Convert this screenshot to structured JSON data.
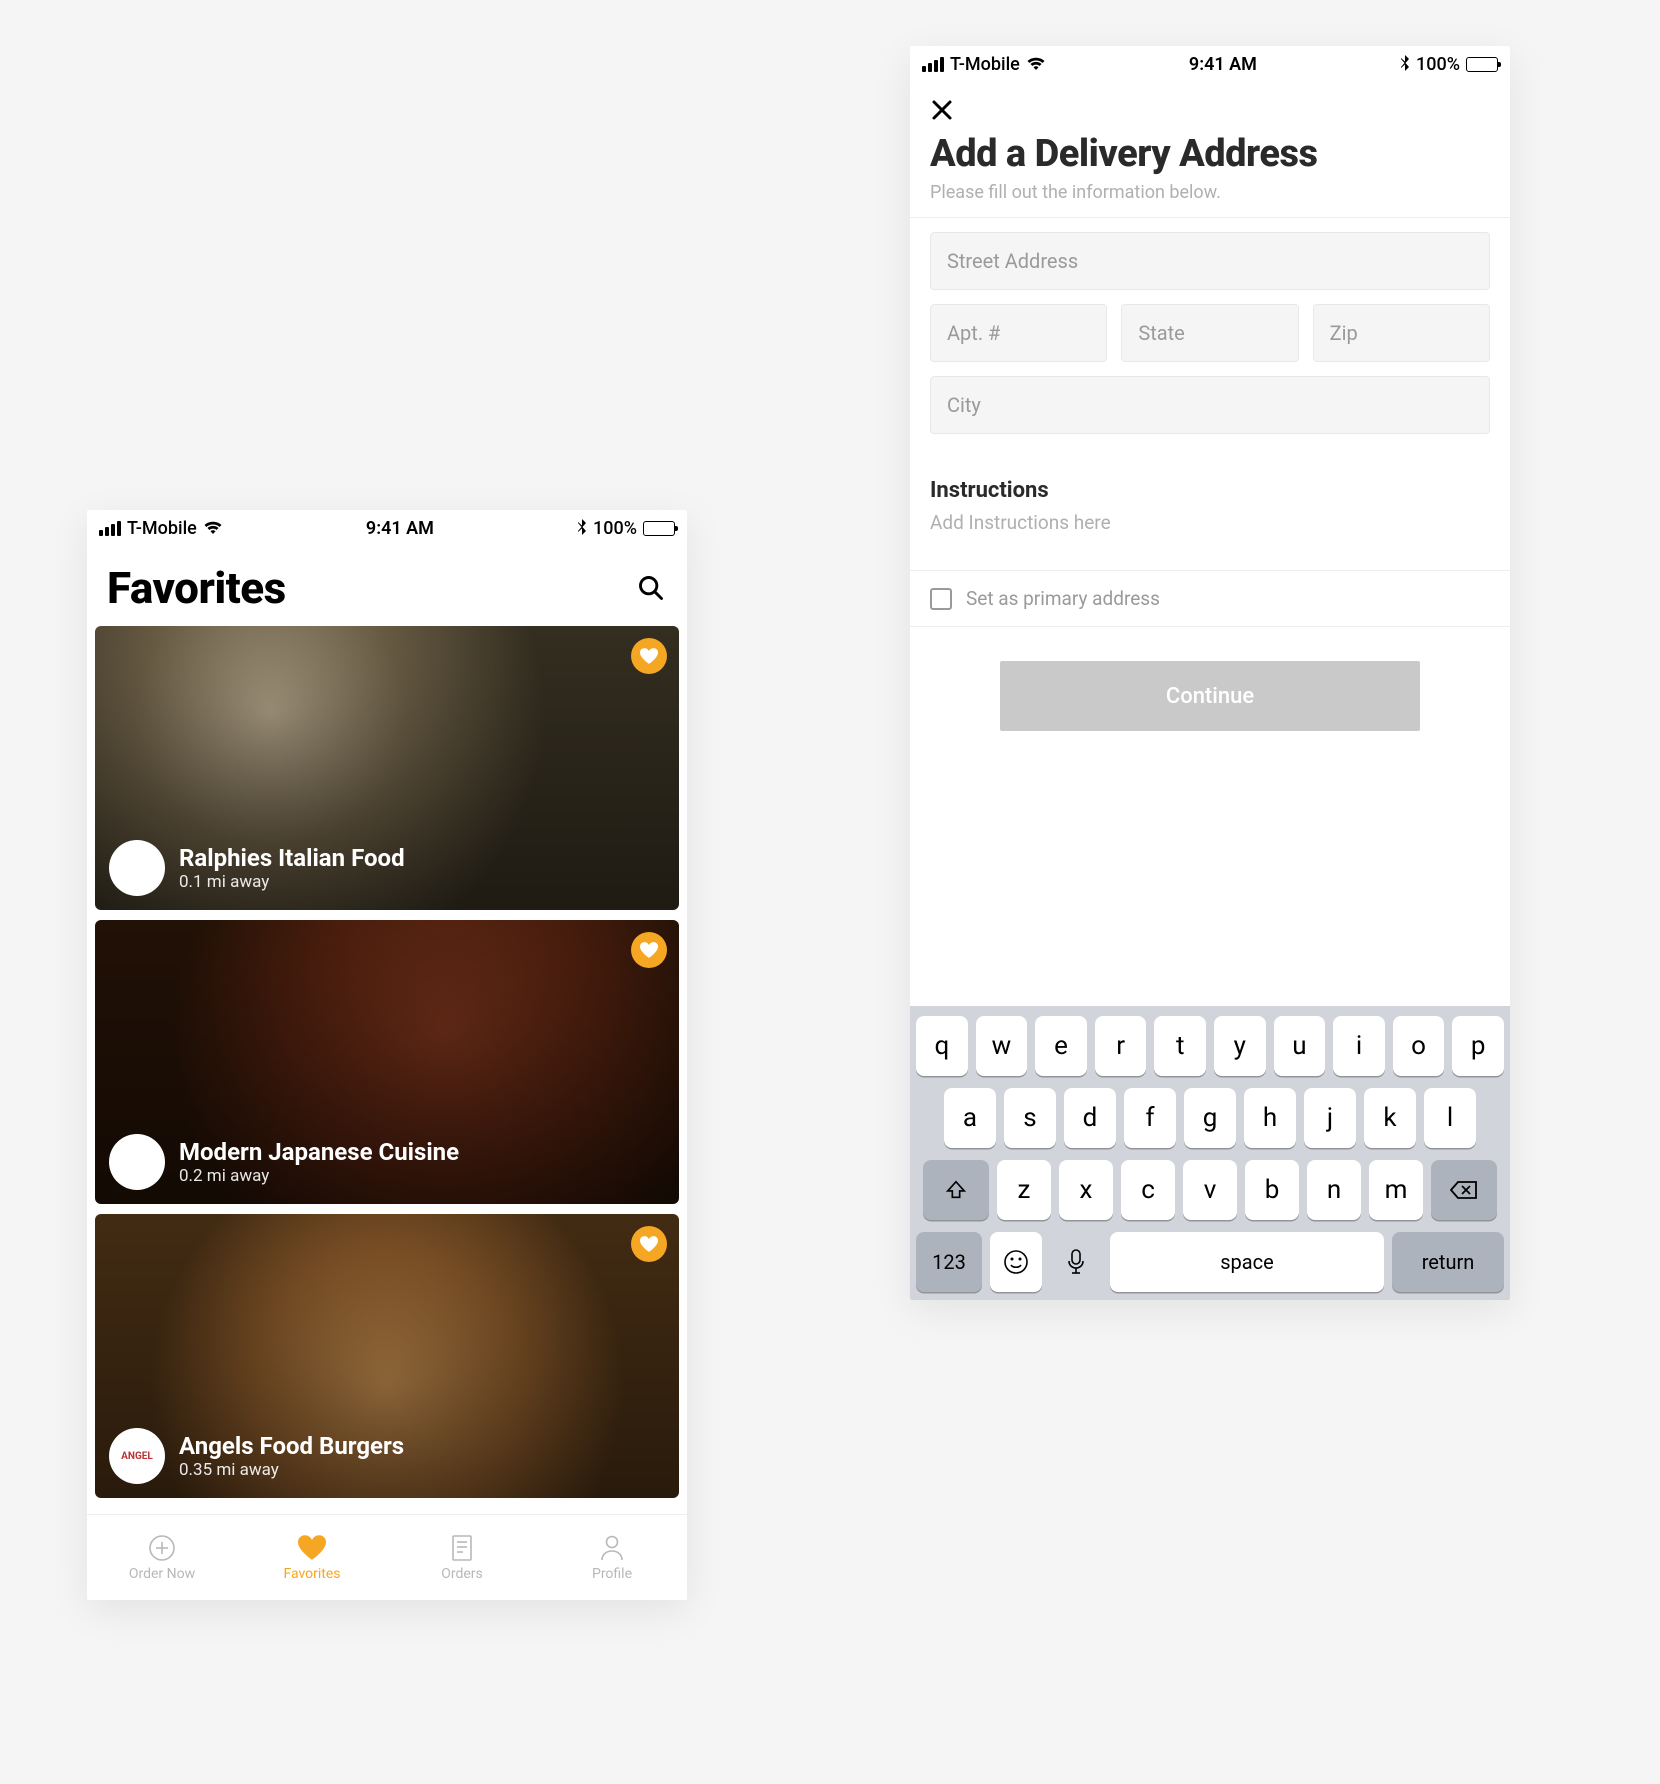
{
  "status": {
    "carrier": "T-Mobile",
    "time": "9:41 AM",
    "battery": "100%"
  },
  "favorites": {
    "title": "Favorites",
    "cards": [
      {
        "name": "Ralphies Italian Food",
        "distance": "0.1 mi away"
      },
      {
        "name": "Modern Japanese Cuisine",
        "distance": "0.2 mi away"
      },
      {
        "name": "Angels Food Burgers",
        "distance": "0.35 mi away"
      }
    ],
    "tabs": [
      {
        "label": "Order Now"
      },
      {
        "label": "Favorites"
      },
      {
        "label": "Orders"
      },
      {
        "label": "Profile"
      }
    ]
  },
  "address": {
    "title": "Add a Delivery Address",
    "subtitle": "Please fill out the information below.",
    "placeholders": {
      "street": "Street Address",
      "apt": "Apt. #",
      "state": "State",
      "zip": "Zip",
      "city": "City"
    },
    "instructions_label": "Instructions",
    "instructions_placeholder": "Add Instructions here",
    "primary_label": "Set as primary address",
    "continue": "Continue"
  },
  "keyboard": {
    "row1": [
      "q",
      "w",
      "e",
      "r",
      "t",
      "y",
      "u",
      "i",
      "o",
      "p"
    ],
    "row2": [
      "a",
      "s",
      "d",
      "f",
      "g",
      "h",
      "j",
      "k",
      "l"
    ],
    "row3": [
      "z",
      "x",
      "c",
      "v",
      "b",
      "n",
      "m"
    ],
    "numkey": "123",
    "space": "space",
    "return": "return"
  }
}
